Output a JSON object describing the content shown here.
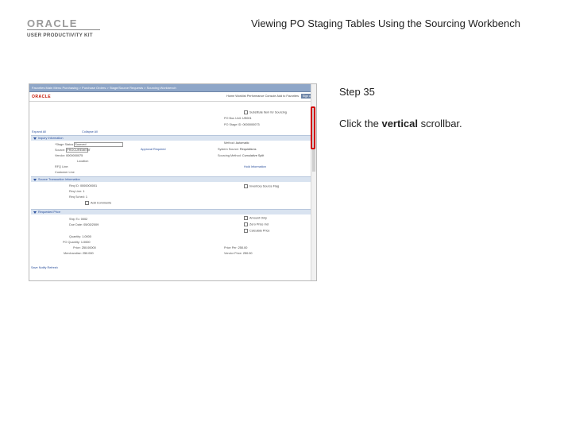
{
  "header": {
    "brand": "ORACLE",
    "brand_sub": "USER PRODUCTIVITY KIT",
    "doc_title": "Viewing PO Staging Tables Using the Sourcing Workbench"
  },
  "step": {
    "label": "Step 35",
    "instruction_before": "Click the ",
    "instruction_emphasis": "vertical",
    "instruction_after": " scrollbar."
  },
  "screenshot": {
    "nav_crumbs": "Favorites    Main Menu    Purchasing  >  Purchase Orders  >  Stage/Source Requests  >  Sourcing Workbench",
    "app_logo": "ORACLE",
    "app_links": "Home    Worklist    Performance Console    Add to Favorites",
    "signout": "Sign out",
    "top_check": "Substitute Item for Sourcing",
    "po_bu_label": "PO Bus Unit:",
    "po_bu_value": "US001",
    "po_id_label": "PO Stage ID:",
    "po_id_value": "0000000073",
    "expand_all": "Expand All",
    "collapse_all": "Collapse All",
    "section_inquiry": "Inquiry Information",
    "stage_status_label": "*Stage Status",
    "stage_status_value": "Sourced",
    "po_source_label": "Source:",
    "po_source_value": "PROCUREMENT",
    "approval_link": "Approval Required",
    "vendor_label": "Vendor:",
    "vendor_value": "0000000075",
    "loc_label": "Location",
    "method_label": "Method:",
    "method_value": "Automatic",
    "sys_source_label": "System Source:",
    "sys_source_value": "Requisitions",
    "sourcing_method_label": "Sourcing Method:",
    "sourcing_method_value": "Cumulative Split",
    "rq_line_label": "RFQ Line:",
    "cust_line_label": "Customer Line",
    "hold_link": "Hold Information",
    "section_source": "Source Transaction Information",
    "req_id_label": "Req ID:",
    "req_id_value": "0000000001",
    "req_line_label": "Req Line:",
    "req_line_value": "1",
    "req_sched_label": "Req Sched:",
    "req_sched_value": "1",
    "sourcing_check": "Inventory Source Flag",
    "add_check": "Add Comments",
    "section_requested": "Requested Price",
    "ship_to_label": "Ship To:",
    "ship_to_value": "0002",
    "due_date_label": "Due Date:",
    "due_date_value": "05/03/2009",
    "uom_check": "Amount Only",
    "zero_check": "Zero Price Ind",
    "cancel_check": "Calculate Price",
    "qty_label": "Quantity:",
    "qty_value": "1.0000",
    "po_qty_label": "PO Quantity:",
    "po_qty_value": "1.0000",
    "price_label": "Price:",
    "price_value": "250.00000",
    "merch_label": "Merchandise:",
    "merch_value": "250.000",
    "price_per_label": "Price Per:",
    "price_per_value": "250.00",
    "vendor_price_label": "Vendor Price:",
    "vendor_price_value": "250.00",
    "footer_links": "Save    Notify    Refresh"
  }
}
